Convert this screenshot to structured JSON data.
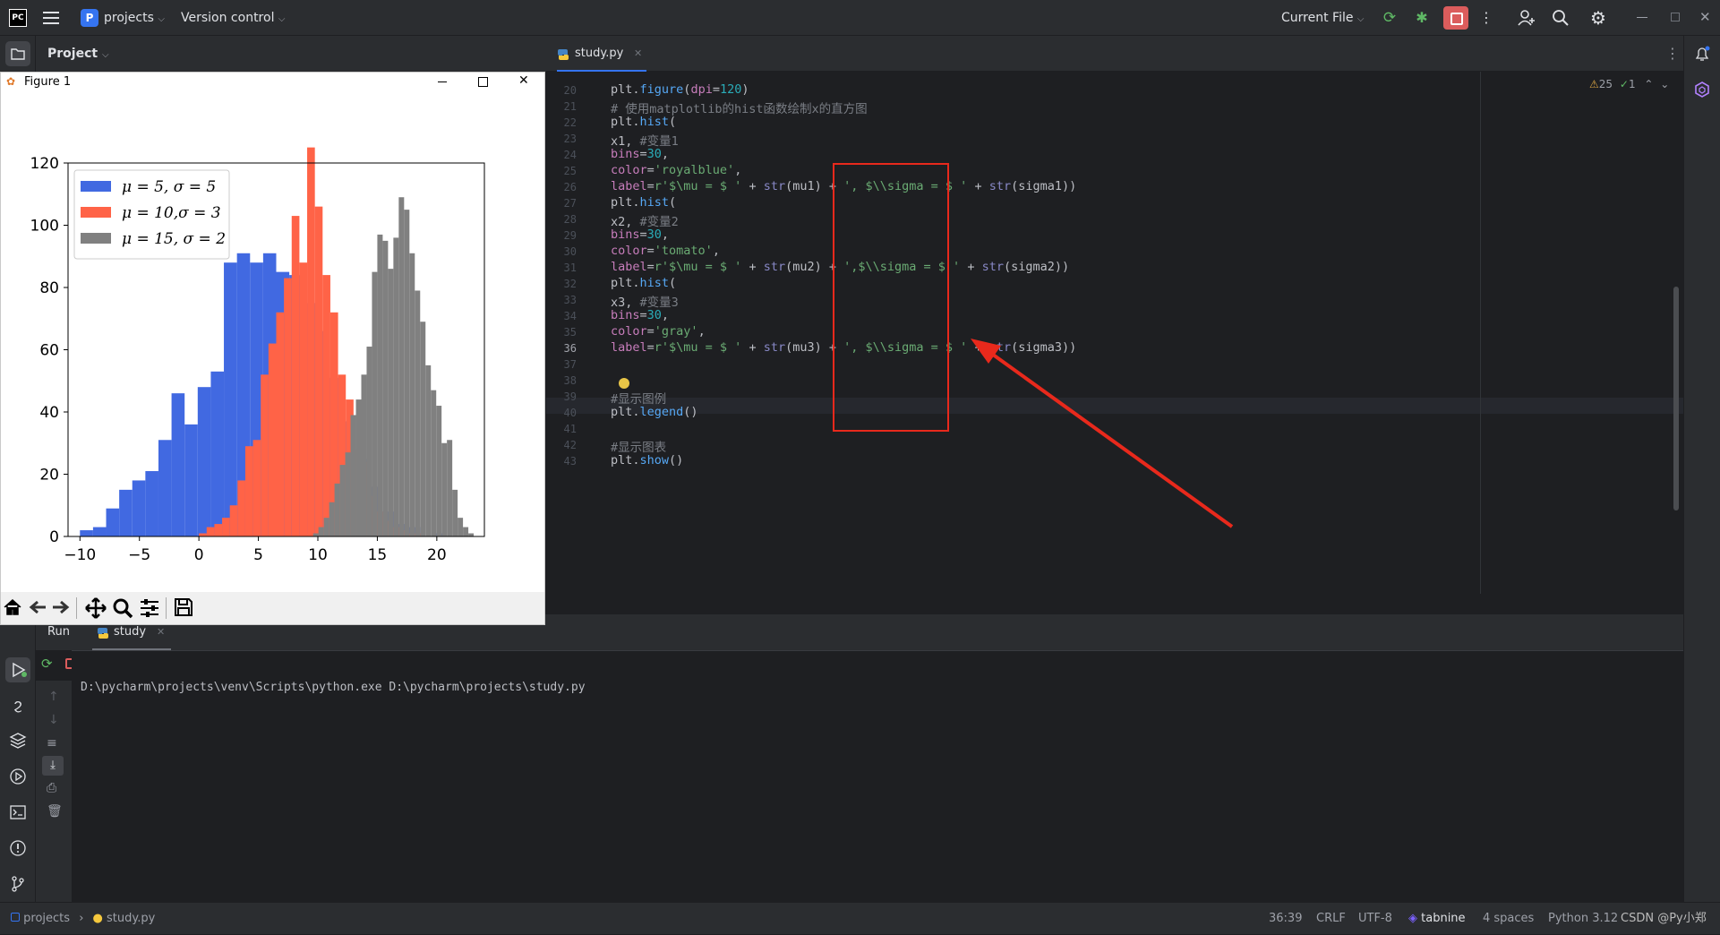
{
  "titlebar": {
    "app_logo": "PC",
    "project_badge": "P",
    "project_name": "projects",
    "vcs_menu": "Version control",
    "run_config": "Current File"
  },
  "project_panel": {
    "title": "Project"
  },
  "editor": {
    "tab_label": "study.py",
    "inspections_warnings": "25",
    "inspections_ok": "1",
    "line_numbers": [
      "20",
      "21",
      "22",
      "23",
      "24",
      "25",
      "26",
      "27",
      "28",
      "29",
      "30",
      "31",
      "32",
      "33",
      "34",
      "35",
      "36",
      "37",
      "38",
      "39",
      "40",
      "41",
      "42",
      "43"
    ]
  },
  "figure_window": {
    "title": "Figure 1",
    "toolbar": [
      "home-icon",
      "back-icon",
      "forward-icon",
      "pan-icon",
      "zoom-icon",
      "configure-icon",
      "save-icon"
    ]
  },
  "run_panel": {
    "title": "Run",
    "tab_label": "study",
    "command": "D:\\pycharm\\projects\\venv\\Scripts\\python.exe D:\\pycharm\\projects\\study.py"
  },
  "statusbar": {
    "breadcrumb_project": "projects",
    "breadcrumb_file": "study.py",
    "position": "36:39",
    "line_sep": "CRLF",
    "encoding": "UTF-8",
    "plugin": "tabnine",
    "indent": "4 spaces",
    "interpreter": "Python 3.12",
    "watermark": "CSDN @Py小郑"
  },
  "colors": {
    "royalblue": "#4169e1",
    "tomato": "#ff6347",
    "gray": "#808080",
    "annotation_red": "#e8291c",
    "accent": "#3574f0"
  },
  "chart_data": {
    "type": "bar",
    "xlim": [
      -11,
      24
    ],
    "ylim": [
      0,
      120
    ],
    "xticks": [
      "−10",
      "−5",
      "0",
      "5",
      "10",
      "15",
      "20"
    ],
    "yticks": [
      "0",
      "20",
      "40",
      "60",
      "80",
      "100",
      "120"
    ],
    "legend_position": "top-left",
    "series": [
      {
        "name": "μ = 5, σ = 5",
        "color": "#4169e1",
        "bin_width": 1.1,
        "start": -10,
        "values": [
          2,
          3,
          9,
          15,
          18,
          21,
          31,
          46,
          36,
          48,
          53,
          88,
          91,
          88,
          91,
          85,
          84,
          75,
          66,
          51,
          37,
          25,
          16,
          8,
          4,
          3,
          0,
          1,
          0,
          0
        ]
      },
      {
        "name": "μ = 10,σ = 3",
        "color": "#ff6347",
        "bin_width": 0.65,
        "start": 0,
        "values": [
          1,
          3,
          4,
          6,
          10,
          18,
          29,
          31,
          52,
          62,
          72,
          83,
          103,
          88,
          125,
          106,
          84,
          72,
          52,
          44,
          28,
          24,
          13,
          8,
          5,
          3,
          2,
          1,
          1,
          0
        ]
      },
      {
        "name": "μ = 15, σ = 2",
        "color": "#808080",
        "bin_width": 0.45,
        "start": 9.6,
        "values": [
          1,
          3,
          6,
          11,
          17,
          23,
          27,
          39,
          44,
          52,
          61,
          85,
          97,
          95,
          86,
          96,
          109,
          105,
          91,
          79,
          69,
          55,
          47,
          42,
          30,
          31,
          15,
          6,
          3,
          1
        ]
      }
    ]
  }
}
